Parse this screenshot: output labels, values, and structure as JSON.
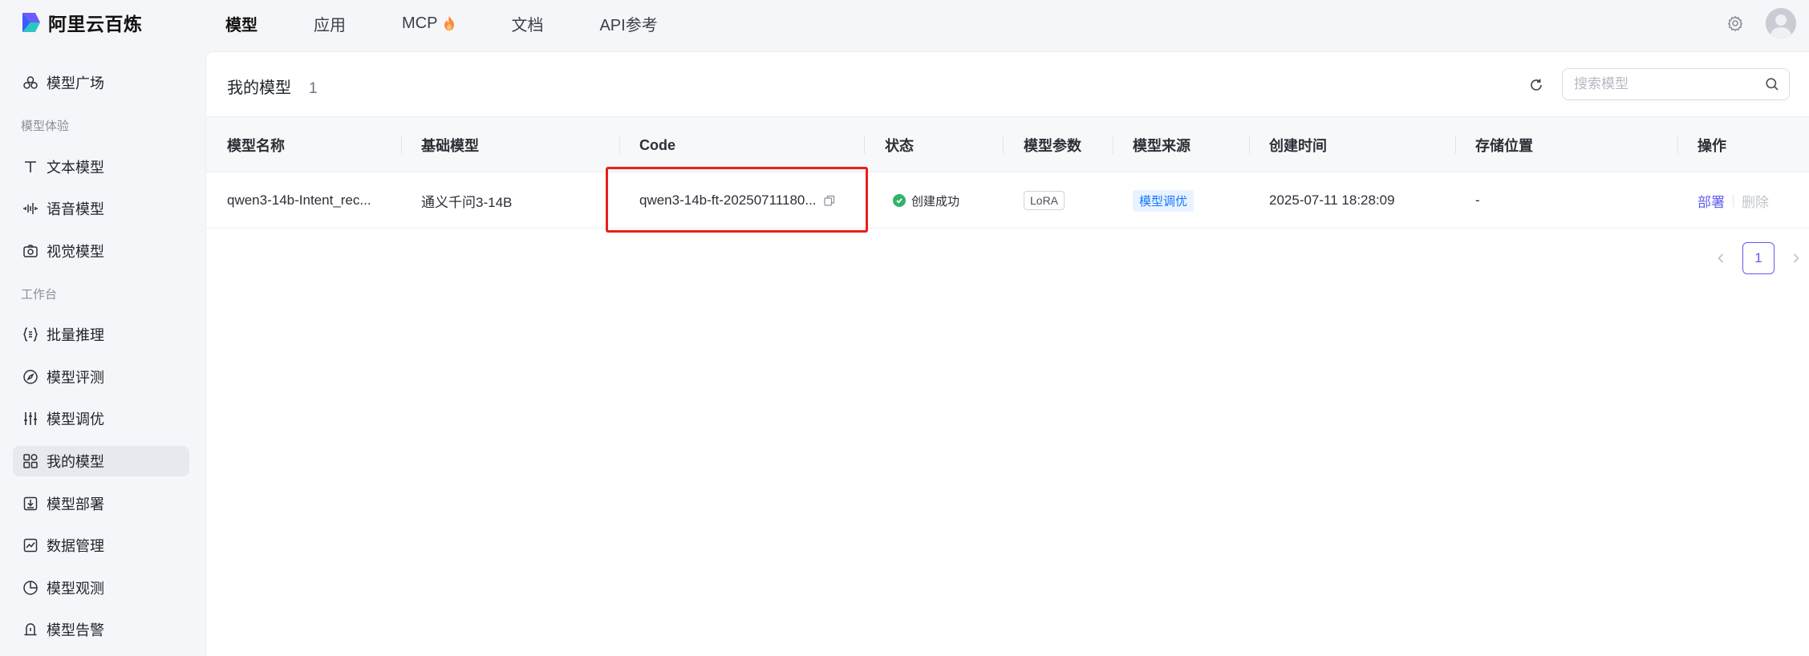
{
  "brand": {
    "name": "阿里云百炼"
  },
  "nav": {
    "items": [
      {
        "label": "模型",
        "active": true
      },
      {
        "label": "应用"
      },
      {
        "label": "MCP",
        "icon": "flame-icon"
      },
      {
        "label": "文档"
      },
      {
        "label": "API参考"
      }
    ]
  },
  "sidebar": {
    "top_item": {
      "label": "模型广场",
      "icon": "model-square-icon"
    },
    "group_experience": "模型体验",
    "experience_items": [
      {
        "label": "文本模型",
        "icon": "text-icon"
      },
      {
        "label": "语音模型",
        "icon": "voice-icon"
      },
      {
        "label": "视觉模型",
        "icon": "camera-icon"
      }
    ],
    "group_workbench": "工作台",
    "workbench_items": [
      {
        "label": "批量推理",
        "icon": "braces-icon"
      },
      {
        "label": "模型评测",
        "icon": "compass-icon"
      },
      {
        "label": "模型调优",
        "icon": "sliders-icon"
      },
      {
        "label": "我的模型",
        "icon": "grid-icon",
        "active": true
      },
      {
        "label": "模型部署",
        "icon": "download-box-icon"
      },
      {
        "label": "数据管理",
        "icon": "line-chart-icon"
      },
      {
        "label": "模型观测",
        "icon": "pie-chart-icon"
      },
      {
        "label": "模型告警",
        "icon": "alarm-icon"
      }
    ]
  },
  "main": {
    "title": "我的模型",
    "count": "1",
    "search": {
      "placeholder": "搜索模型",
      "value": ""
    },
    "columns": [
      "模型名称",
      "基础模型",
      "Code",
      "状态",
      "模型参数",
      "模型来源",
      "创建时间",
      "存储位置",
      "操作"
    ],
    "rows": [
      {
        "name": "qwen3-14b-Intent_rec...",
        "base_model": "通义千问3-14B",
        "code": "qwen3-14b-ft-20250711180...",
        "status": "创建成功",
        "params": "LoRA",
        "source": "模型调优",
        "created": "2025-07-11 18:28:09",
        "storage": "-",
        "op_deploy": "部署",
        "op_delete": "删除"
      }
    ],
    "pagination": {
      "current": "1"
    }
  },
  "colors": {
    "accent": "#615ced",
    "success": "#2fb46a",
    "highlight": "#e8201b",
    "source_tag_bg": "#e8f3ff",
    "source_tag_text": "#1677ff"
  }
}
